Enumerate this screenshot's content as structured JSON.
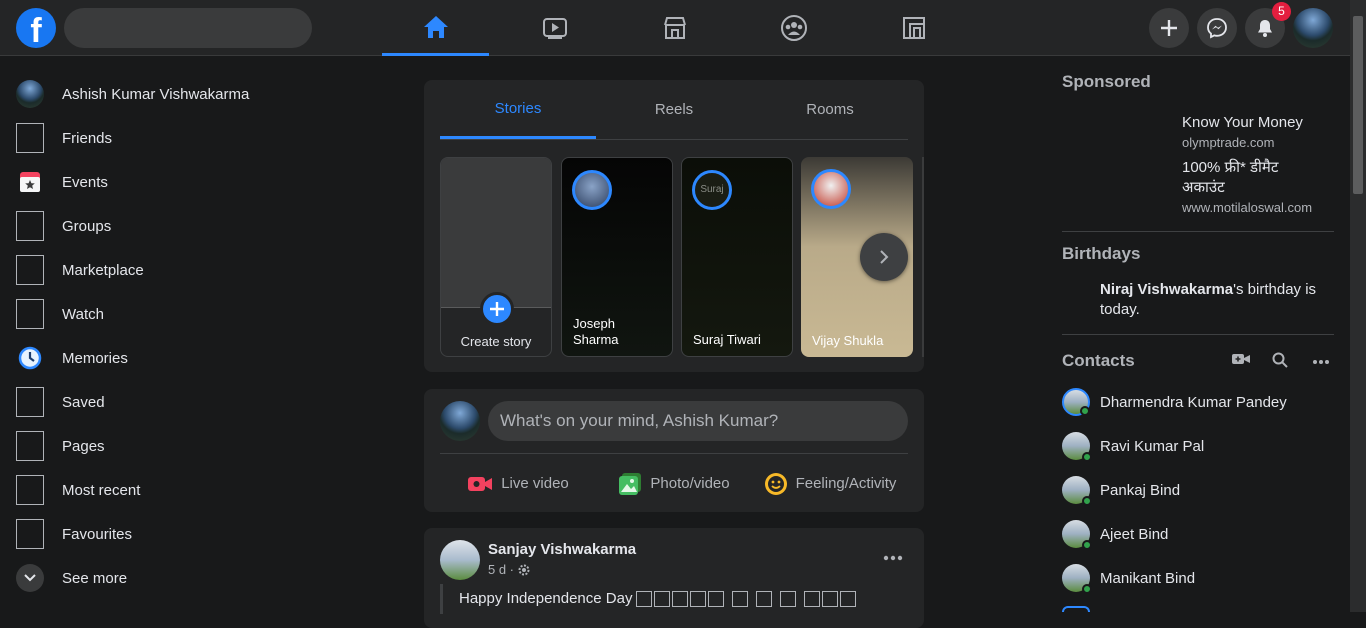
{
  "topbar": {
    "logo": "f",
    "search_placeholder": "",
    "nav_icons": [
      "home-icon",
      "watch-icon",
      "marketplace-icon",
      "groups-icon",
      "gaming-icon"
    ],
    "notifications_badge": "5"
  },
  "left_nav": {
    "profile_name": "Ashish Kumar Vishwakarma",
    "items": [
      {
        "label": "Friends"
      },
      {
        "label": "Events"
      },
      {
        "label": "Groups"
      },
      {
        "label": "Marketplace"
      },
      {
        "label": "Watch"
      },
      {
        "label": "Memories"
      },
      {
        "label": "Saved"
      },
      {
        "label": "Pages"
      },
      {
        "label": "Most recent"
      },
      {
        "label": "Favourites"
      }
    ],
    "see_more": "See more"
  },
  "stories": {
    "tabs": [
      "Stories",
      "Reels",
      "Rooms"
    ],
    "create_label": "Create story",
    "items": [
      {
        "name": "Joseph Sharma"
      },
      {
        "name": "Suraj Tiwari",
        "ring_text": "Suraj"
      },
      {
        "name": "Vijay Shukla"
      }
    ]
  },
  "composer": {
    "placeholder": "What's on your mind, Ashish Kumar?",
    "actions": [
      {
        "label": "Live video",
        "color": "#f3425f"
      },
      {
        "label": "Photo/video",
        "color": "#45bd62"
      },
      {
        "label": "Feeling/Activity",
        "color": "#f7b928"
      }
    ]
  },
  "post": {
    "author": "Sanjay Vishwakarma",
    "meta": "5 d ·",
    "text": "Happy Independence Day"
  },
  "sidebar_right": {
    "sponsored_title": "Sponsored",
    "ads": [
      {
        "title": "Know Your Money",
        "domain": "olymptrade.com"
      },
      {
        "title": "100% फ्री* डीमैट अकाउंट",
        "domain": "www.motilaloswal.com"
      }
    ],
    "birthdays_title": "Birthdays",
    "birthday_name": "Niraj Vishwakarma",
    "birthday_text": "'s birthday is today.",
    "contacts_title": "Contacts",
    "contacts": [
      {
        "name": "Dharmendra Kumar Pandey"
      },
      {
        "name": "Ravi Kumar Pal"
      },
      {
        "name": "Pankaj Bind"
      },
      {
        "name": "Ajeet Bind"
      },
      {
        "name": "Manikant Bind"
      }
    ]
  },
  "colors": {
    "accent": "#2d88ff",
    "background": "#18191a",
    "surface": "#242526"
  }
}
